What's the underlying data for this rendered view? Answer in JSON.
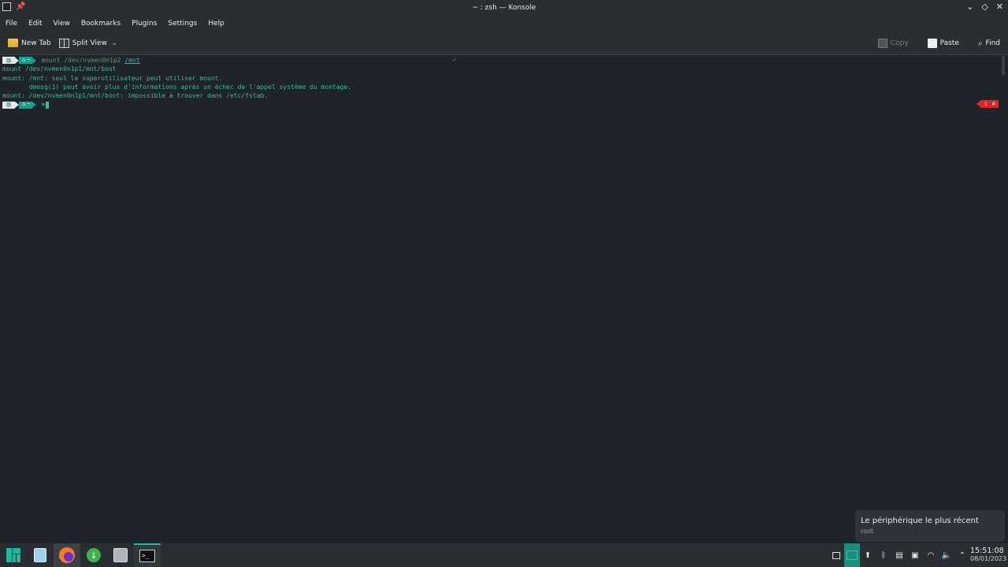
{
  "window": {
    "title": "~ : zsh — Konsole",
    "controls": [
      "minimize",
      "maximize",
      "close"
    ]
  },
  "menubar": {
    "items": [
      "File",
      "Edit",
      "View",
      "Bookmarks",
      "Plugins",
      "Settings",
      "Help"
    ]
  },
  "toolbar": {
    "new_tab": "New Tab",
    "split_view": "Split View",
    "copy": "Copy",
    "paste": "Paste",
    "find": "Find"
  },
  "terminal": {
    "prompt1": {
      "home": "~",
      "command": "mount /dev/nvmen0n1p2",
      "arg": "/mnt",
      "status": "✓"
    },
    "lines": [
      "mount /dev/nvmen0n1p1/mnt/boot",
      "mount: /mnt: seul le superutilisateur peut utiliser mount.",
      "       dmesg(1) peut avoir plus d'informations après un échec de l'appel système du montage.",
      "mount: /dev/nvmen0n1p1/mnt/boot: impossible à trouver dans /etc/fstab."
    ],
    "prompt2": {
      "home": "~",
      "symbol": "≡",
      "error_code": "1",
      "error_mark": "✘"
    }
  },
  "notification": {
    "title": "Le périphérique le plus récent",
    "subtitle": "root"
  },
  "taskbar": {
    "apps": [
      "manjaro-menu",
      "file-manager",
      "firefox",
      "downloader",
      "disk-utility",
      "konsole"
    ],
    "clock": {
      "time": "15:51:08",
      "date": "08/01/2023"
    }
  }
}
